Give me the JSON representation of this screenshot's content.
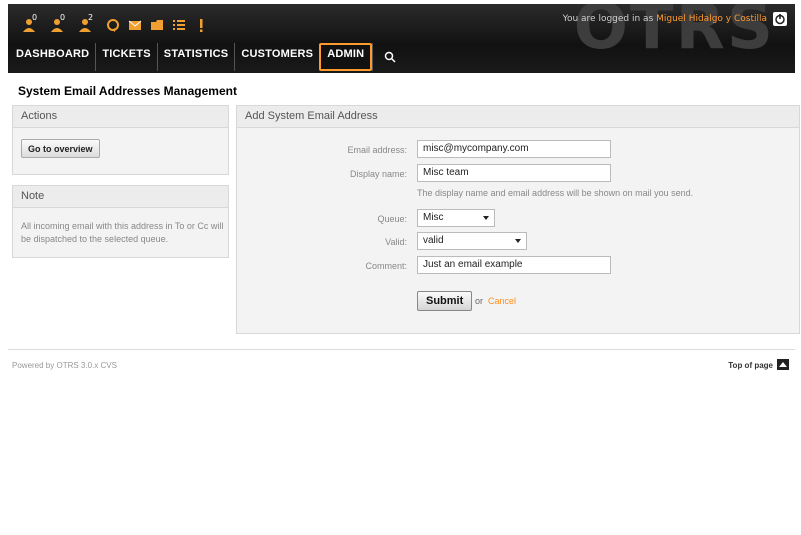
{
  "header": {
    "logo": "OTRS",
    "login_prefix": "You are logged in as ",
    "user_name": "Miguel Hidalgo y Costilla",
    "toolbar": [
      {
        "icon": "locked-tickets-icon",
        "count": "0"
      },
      {
        "icon": "watched-tickets-icon",
        "count": "0"
      },
      {
        "icon": "responsible-tickets-icon",
        "count": "2"
      },
      {
        "icon": "refresh-icon"
      },
      {
        "icon": "email-icon"
      },
      {
        "icon": "folder-icon"
      },
      {
        "icon": "list-icon"
      },
      {
        "icon": "alert-icon"
      }
    ]
  },
  "nav": {
    "items": [
      "DASHBOARD",
      "TICKETS",
      "STATISTICS",
      "CUSTOMERS",
      "ADMIN"
    ],
    "active": "ADMIN"
  },
  "page": {
    "title": "System Email Addresses Management"
  },
  "actions": {
    "header": "Actions",
    "go_to_overview": "Go to overview"
  },
  "note": {
    "header": "Note",
    "text": "All incoming email with this address in To or Cc will be dispatched to the selected queue."
  },
  "form": {
    "header": "Add System Email Address",
    "email_label": "Email address:",
    "email_value": "misc@mycompany.com",
    "display_label": "Display name:",
    "display_value": "Misc team",
    "display_hint": "The display name and email address will be shown on mail you send.",
    "queue_label": "Queue:",
    "queue_value": "Misc",
    "valid_label": "Valid:",
    "valid_value": "valid",
    "comment_label": "Comment:",
    "comment_value": "Just an email example",
    "submit": "Submit",
    "or": "or",
    "cancel": "Cancel"
  },
  "footer": {
    "powered": "Powered by OTRS 3.0.x CVS",
    "top_of_page": "Top of page"
  },
  "colors": {
    "accent": "#ff9a2e",
    "header_bg": "#1a1a1a"
  }
}
